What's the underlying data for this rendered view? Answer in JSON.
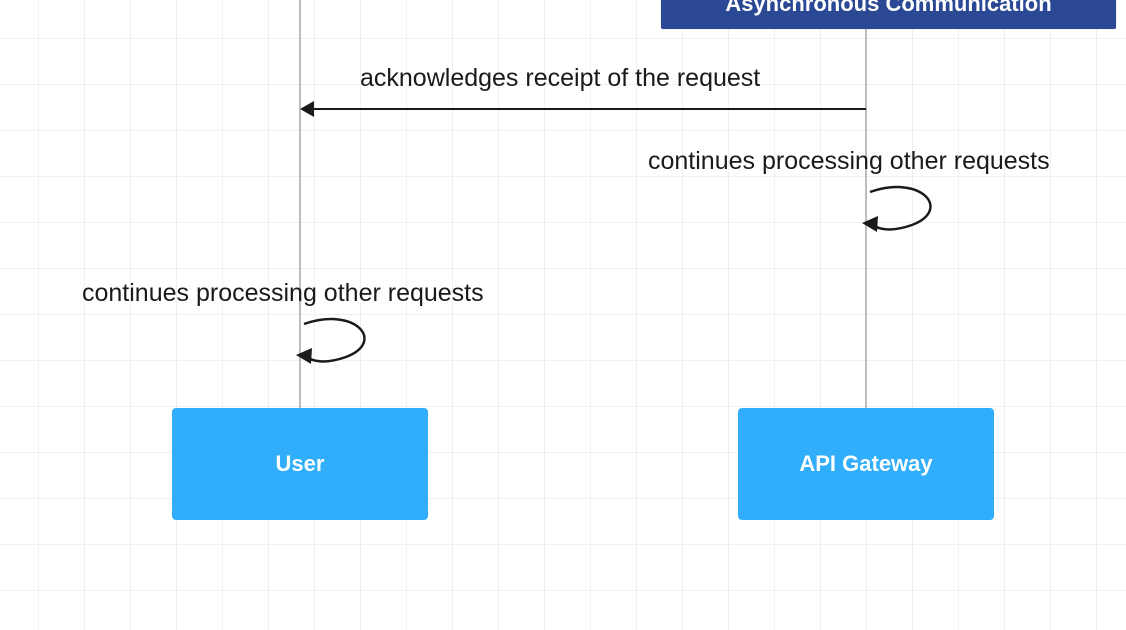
{
  "note": {
    "label": "Asynchronous Communication"
  },
  "messages": {
    "ack": "acknowledges receipt of the request",
    "api_loop": "continues processing other requests",
    "user_loop": "continues processing other requests"
  },
  "actors": {
    "user": "User",
    "gateway": "API Gateway"
  },
  "colors": {
    "note_bg": "#2b4894",
    "actor_bg": "#30aefc",
    "line": "#1a1a1a",
    "lifeline": "#bdbdbd"
  }
}
